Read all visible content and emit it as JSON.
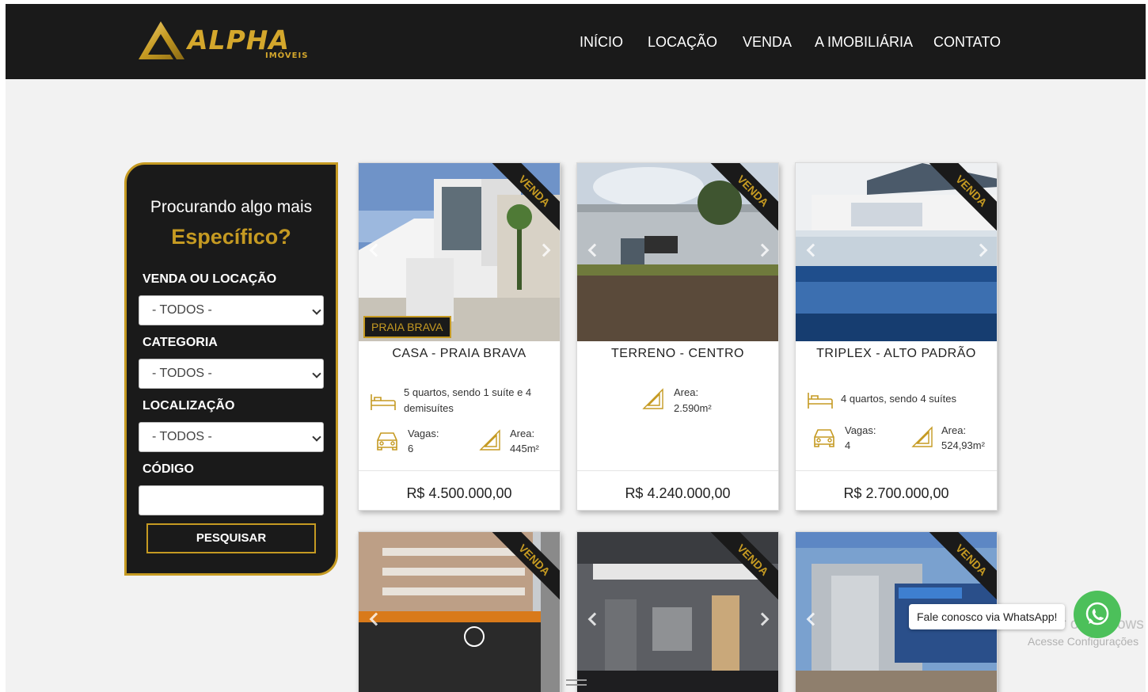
{
  "brand": {
    "name": "ALPHA",
    "sub": "IMÓVEIS",
    "colors": {
      "gold": "#c59a22",
      "dark": "#1a1a1a",
      "background": "#f2f2f2",
      "whatsapp": "#4cc05a"
    }
  },
  "nav": {
    "items": [
      "INÍCIO",
      "LOCAÇÃO",
      "VENDA",
      "A IMOBILIÁRIA",
      "CONTATO"
    ]
  },
  "search": {
    "title_line1": "Procurando algo mais",
    "title_line2": "Específico?",
    "fields": [
      {
        "label": "VENDA OU LOCAÇÃO",
        "value": "- TODOS -"
      },
      {
        "label": "CATEGORIA",
        "value": "- TODOS -"
      },
      {
        "label": "LOCALIZAÇÃO",
        "value": "- TODOS -"
      }
    ],
    "code_label": "CÓDIGO",
    "code_value": "",
    "button": "PESQUISAR"
  },
  "properties": [
    {
      "ribbon": "VENDA",
      "tag": "PRAIA BRAVA",
      "title": "CASA - PRAIA BRAVA",
      "rooms": "5 quartos, sendo 1 suíte e 4 demisuítes",
      "parking_label": "Vagas:",
      "parking": "6",
      "area_label": "Area:",
      "area": "445m²",
      "price": "R$ 4.500.000,00"
    },
    {
      "ribbon": "VENDA",
      "title": "TERRENO - CENTRO",
      "area_label": "Area:",
      "area": "2.590m²",
      "price": "R$ 4.240.000,00"
    },
    {
      "ribbon": "VENDA",
      "title": "TRIPLEX - ALTO PADRÃO",
      "rooms": "4 quartos, sendo 4 suítes",
      "parking_label": "Vagas:",
      "parking": "4",
      "area_label": "Area:",
      "area": "524,93m²",
      "price": "R$ 2.700.000,00"
    },
    {
      "ribbon": "VENDA"
    },
    {
      "ribbon": "VENDA"
    },
    {
      "ribbon": "VENDA"
    }
  ],
  "whatsapp": {
    "label": "Fale conosco via WhatsApp!",
    "icon": "whatsapp-icon"
  },
  "os_watermark": {
    "line1": "Ativar o Windows",
    "line2": "Acesse Configurações"
  }
}
